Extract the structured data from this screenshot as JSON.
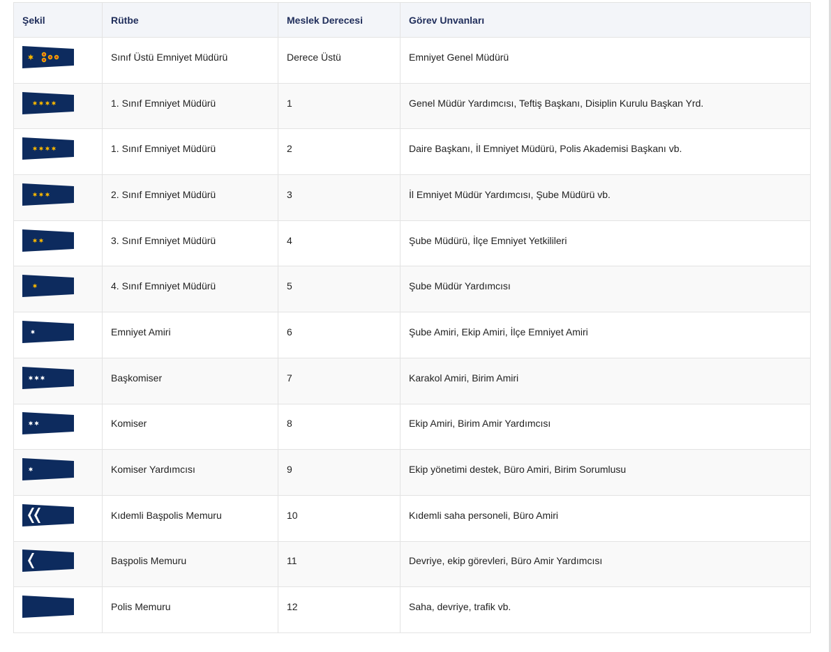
{
  "table": {
    "headers": [
      "Şekil",
      "Rütbe",
      "Meslek Derecesi",
      "Görev Unvanları"
    ],
    "rows": [
      {
        "badge": "insignia-gold-crescent-sun-rosettes-icon",
        "rank": "Sınıf Üstü Emniyet Müdürü",
        "degree": "Derece Üstü",
        "duties": "Emniyet Genel Müdürü"
      },
      {
        "badge": "insignia-gold-crescent-4-stars-icon",
        "rank": "1. Sınıf Emniyet Müdürü",
        "degree": "1",
        "duties": "Genel Müdür Yardımcısı, Teftiş Başkanı, Disiplin Kurulu Başkan Yrd."
      },
      {
        "badge": "insignia-gold-crescent-4-stars-icon",
        "rank": "1. Sınıf Emniyet Müdürü",
        "degree": "2",
        "duties": "Daire Başkanı, İl Emniyet Müdürü, Polis Akademisi Başkanı vb."
      },
      {
        "badge": "insignia-gold-crescent-3-stars-icon",
        "rank": "2. Sınıf Emniyet Müdürü",
        "degree": "3",
        "duties": "İl Emniyet Müdür Yardımcısı, Şube Müdürü vb."
      },
      {
        "badge": "insignia-gold-crescent-2-stars-icon",
        "rank": "3. Sınıf Emniyet Müdürü",
        "degree": "4",
        "duties": "Şube Müdürü, İlçe Emniyet Yetkilileri"
      },
      {
        "badge": "insignia-gold-crescent-1-star-icon",
        "rank": "4. Sınıf Emniyet Müdürü",
        "degree": "5",
        "duties": "Şube Müdür Yardımcısı"
      },
      {
        "badge": "insignia-white-crescent-star-icon",
        "rank": "Emniyet Amiri",
        "degree": "6",
        "duties": "Şube Amiri, Ekip Amiri, İlçe Emniyet Amiri"
      },
      {
        "badge": "insignia-white-3-stars-icon",
        "rank": "Başkomiser",
        "degree": "7",
        "duties": "Karakol Amiri, Birim Amiri"
      },
      {
        "badge": "insignia-white-2-stars-icon",
        "rank": "Komiser",
        "degree": "8",
        "duties": "Ekip Amiri, Birim Amir Yardımcısı"
      },
      {
        "badge": "insignia-white-1-star-icon",
        "rank": "Komiser Yardımcısı",
        "degree": "9",
        "duties": "Ekip yönetimi destek, Büro Amiri, Birim Sorumlusu"
      },
      {
        "badge": "insignia-white-2-chevrons-icon",
        "rank": "Kıdemli Başpolis Memuru",
        "degree": "10",
        "duties": "Kıdemli saha personeli, Büro Amiri"
      },
      {
        "badge": "insignia-white-1-chevron-icon",
        "rank": "Başpolis Memuru",
        "degree": "11",
        "duties": "Devriye, ekip görevleri, Büro Amir Yardımcısı"
      },
      {
        "badge": "insignia-plain-icon",
        "rank": "Polis Memuru",
        "degree": "12",
        "duties": "Saha, devriye, trafik vb."
      }
    ]
  },
  "colors": {
    "badge_navy": "#0d2b5e",
    "gold": "#f4b400",
    "white": "#ffffff",
    "header_bg": "#f3f5f9",
    "header_text": "#1f2d5a",
    "border": "#e3e3e3"
  }
}
